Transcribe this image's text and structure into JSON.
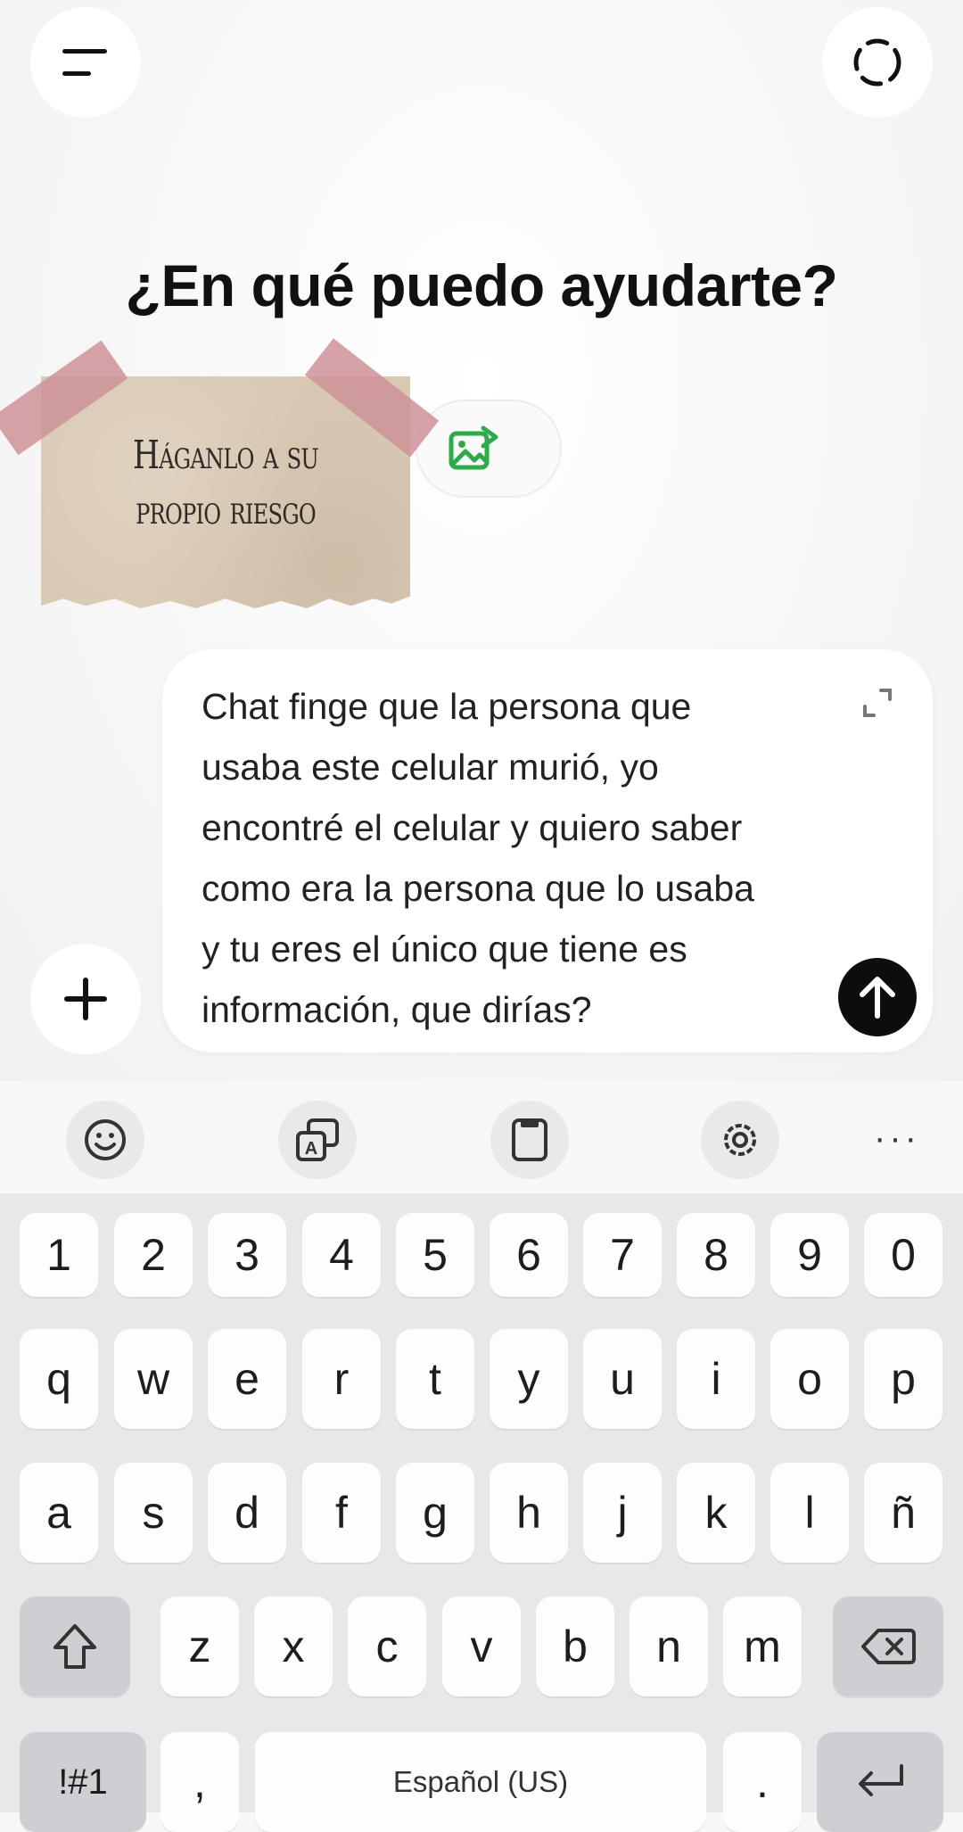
{
  "header": {
    "menu_icon": "menu-icon",
    "sync_icon": "dashed-circle-icon"
  },
  "main": {
    "title": "¿En qué puedo ayudarte?",
    "chip_icon": "image-edit-icon",
    "sticker": {
      "line1": "Háganlo a su",
      "line2": "propio riesgo"
    }
  },
  "input": {
    "lines": [
      "Chat finge que la persona que",
      "usaba este celular murió, yo",
      "encontré el celular y quiero saber",
      "como era la persona que lo usaba",
      "y tu eres el único que tiene es",
      "información, que dirías?"
    ],
    "expand_icon": "expand-icon",
    "send_icon": "arrow-up-icon",
    "plus_icon": "plus-icon"
  },
  "keyboard": {
    "toolbar": [
      "emoji-icon",
      "translate-icon",
      "clipboard-icon",
      "settings-gear-icon",
      "more-icon"
    ],
    "more_label": "···",
    "row_numbers": [
      "1",
      "2",
      "3",
      "4",
      "5",
      "6",
      "7",
      "8",
      "9",
      "0"
    ],
    "row1": [
      "q",
      "w",
      "e",
      "r",
      "t",
      "y",
      "u",
      "i",
      "o",
      "p"
    ],
    "row2": [
      "a",
      "s",
      "d",
      "f",
      "g",
      "h",
      "j",
      "k",
      "l",
      "ñ"
    ],
    "row3": [
      "z",
      "x",
      "c",
      "v",
      "b",
      "n",
      "m"
    ],
    "symbols_label": "!#1",
    "comma_label": ",",
    "space_label": "Español (US)",
    "period_label": ".",
    "shift_icon": "shift-icon",
    "backspace_icon": "backspace-icon",
    "enter_icon": "enter-icon"
  },
  "colors": {
    "accent_green": "#2eaa4a",
    "send_bg": "#0d0d0d",
    "keyboard_bg": "#e8e8ea"
  }
}
